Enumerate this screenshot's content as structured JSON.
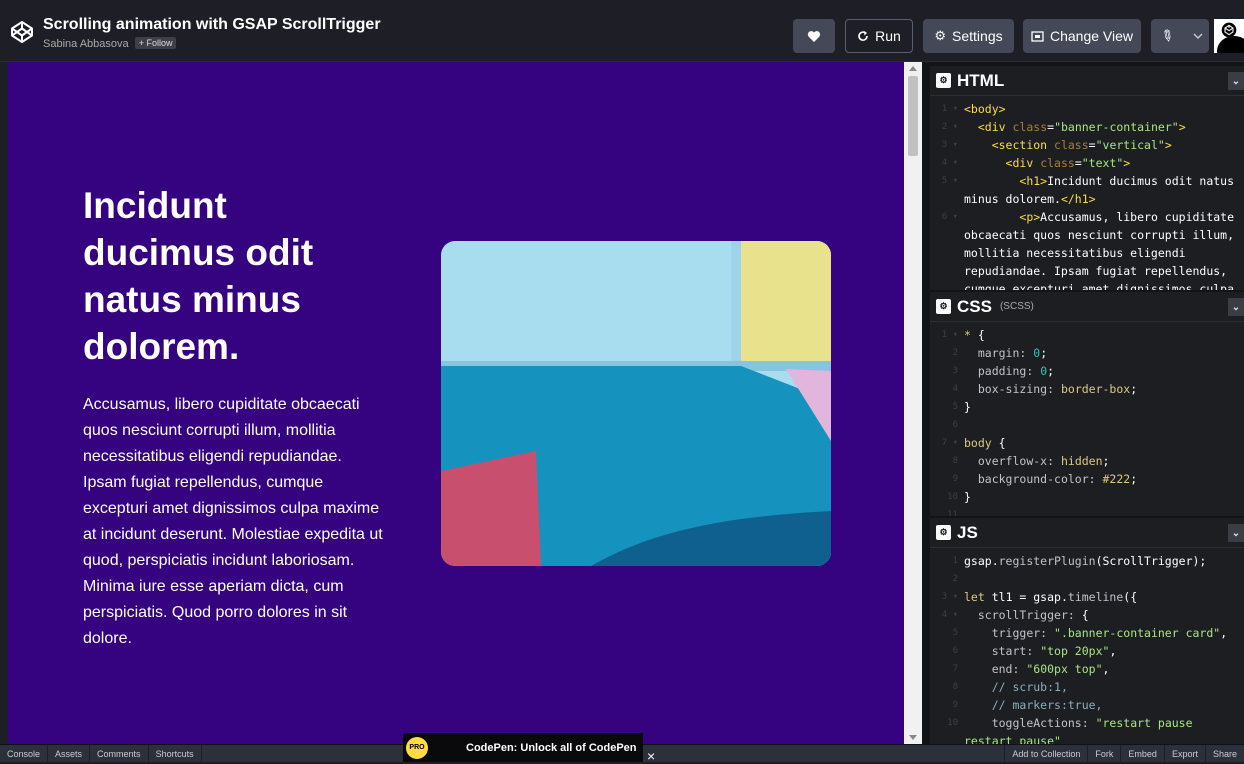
{
  "header": {
    "title": "Scrolling animation with GSAP ScrollTrigger",
    "author": "Sabina Abbasova",
    "follow_label": "+ Follow",
    "run_label": "Run",
    "settings_label": "Settings",
    "change_view_label": "Change View"
  },
  "preview": {
    "heading": "Incidunt ducimus odit natus minus dolorem.",
    "paragraph": "Accusamus, libero cupiditate obcaecati quos nesciunt corrupti illum, mollitia necessitatibus eligendi repudiandae. Ipsam fugiat repellendus, cumque excepturi amet dignissimos culpa maxime at incidunt deserunt. Molestiae expedita ut quod, perspiciatis incidunt laboriosam. Minima iure esse aperiam dicta, cum perspiciatis. Quod porro dolores in sit dolore.",
    "background_color": "#35037f"
  },
  "editors": {
    "html_title": "HTML",
    "css_title": "CSS",
    "css_sub": "(SCSS)",
    "js_title": "JS"
  },
  "footer": {
    "left": [
      "Console",
      "Assets",
      "Comments",
      "Shortcuts"
    ],
    "right": [
      "Add to Collection",
      "Fork",
      "Embed",
      "Export",
      "Share"
    ],
    "promo_badge": "PRO",
    "promo_text": "CodePen: Unlock all of CodePen",
    "promo_close": "×"
  },
  "icons": [
    "codepen-logo-icon",
    "heart-icon",
    "run-icon",
    "gear-icon",
    "change-view-icon",
    "pin-icon",
    "chevron-down-icon",
    "close-icon"
  ]
}
